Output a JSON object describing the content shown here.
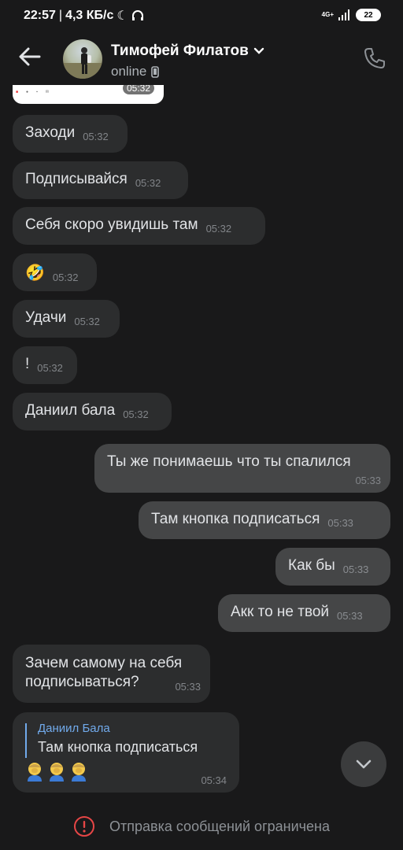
{
  "status_bar": {
    "time": "22:57",
    "separator": "|",
    "speed": "4,3 КБ/с",
    "network": "4G+",
    "battery": "22"
  },
  "header": {
    "contact_name": "Тимофей Филатов",
    "status": "online"
  },
  "preview": {
    "time": "05:32"
  },
  "messages": [
    {
      "text": "Заходи",
      "time": "05:32",
      "dir": "in"
    },
    {
      "text": "Подписывайся",
      "time": "05:32",
      "dir": "in"
    },
    {
      "text": "Себя скоро увидишь там",
      "time": "05:32",
      "dir": "in"
    },
    {
      "text": "🤣",
      "time": "05:32",
      "dir": "in"
    },
    {
      "text": "Удачи",
      "time": "05:32",
      "dir": "in"
    },
    {
      "text": "!",
      "time": "05:32",
      "dir": "in"
    },
    {
      "text": "Даниил бала",
      "time": "05:32",
      "dir": "in"
    },
    {
      "text": "Ты же понимаешь что ты спалился",
      "time": "05:33",
      "dir": "out"
    },
    {
      "text": "Там кнопка подписаться",
      "time": "05:33",
      "dir": "out"
    },
    {
      "text": "Как бы",
      "time": "05:33",
      "dir": "out"
    },
    {
      "text": "Акк то не твой",
      "time": "05:33",
      "dir": "out"
    },
    {
      "text": "Зачем самому на себя подписываться?",
      "time": "05:33",
      "dir": "in"
    }
  ],
  "reply_message": {
    "quoted_author": "Даниил Бала",
    "quoted_text": "Там кнопка подписаться",
    "emojis": [
      "man-facepalming",
      "man-facepalming",
      "man-facepalming"
    ],
    "time": "05:34"
  },
  "footer": {
    "notice": "Отправка сообщений ограничена"
  },
  "colors": {
    "background": "#19191a",
    "incoming_bubble": "#2c2d2e",
    "outgoing_bubble": "#454647",
    "accent_blue": "#71aaeb",
    "warning_red": "#e64646"
  }
}
